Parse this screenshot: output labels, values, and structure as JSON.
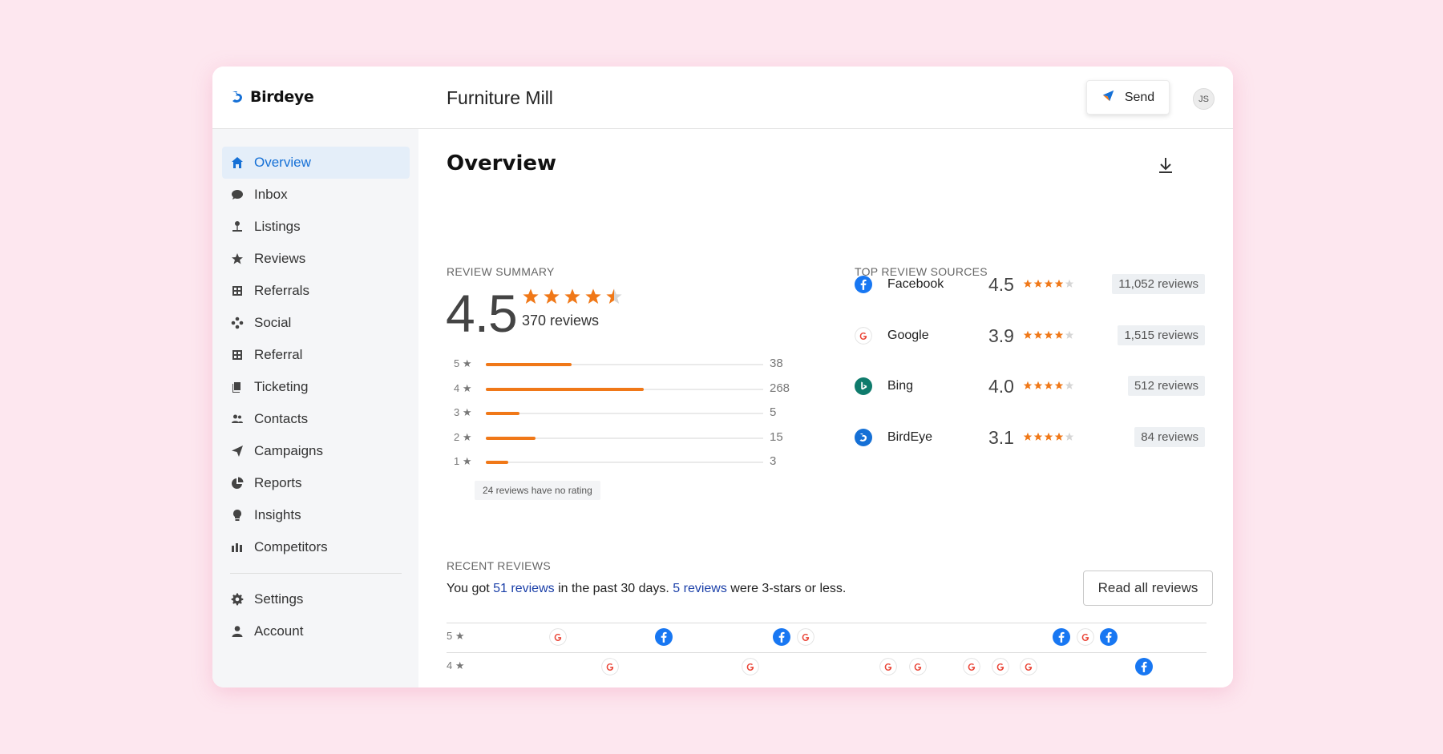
{
  "app": {
    "logo_text": "Birdeye",
    "business_name": "Furniture Mill",
    "send_label": "Send",
    "avatar_initials": "JS"
  },
  "colors": {
    "background": "#fde7ef",
    "accent": "#1570d6",
    "star": "#f07818",
    "link": "#1a3fa8"
  },
  "sidebar": {
    "items": [
      {
        "label": "Overview",
        "icon": "home-icon",
        "active": true
      },
      {
        "label": "Inbox",
        "icon": "chat-icon"
      },
      {
        "label": "Listings",
        "icon": "location-pin-icon"
      },
      {
        "label": "Reviews",
        "icon": "star-icon"
      },
      {
        "label": "Referrals",
        "icon": "referrals-icon"
      },
      {
        "label": "Social",
        "icon": "social-icon"
      },
      {
        "label": "Referral",
        "icon": "referral-icon"
      },
      {
        "label": "Ticketing",
        "icon": "ticket-icon"
      },
      {
        "label": "Contacts",
        "icon": "contacts-icon"
      },
      {
        "label": "Campaigns",
        "icon": "paper-plane-icon"
      },
      {
        "label": "Reports",
        "icon": "pie-chart-icon"
      },
      {
        "label": "Insights",
        "icon": "lightbulb-icon"
      },
      {
        "label": "Competitors",
        "icon": "bar-chart-icon"
      }
    ],
    "bottom_items": [
      {
        "label": "Settings",
        "icon": "gear-icon"
      },
      {
        "label": "Account",
        "icon": "person-icon"
      }
    ]
  },
  "main": {
    "title": "Overview",
    "review_summary": {
      "label": "REVIEW SUMMARY",
      "average": "4.5",
      "average_value": 4.5,
      "total_label": "370 reviews",
      "distribution": [
        {
          "stars": "5",
          "count": "38",
          "fill": 0.31
        },
        {
          "stars": "4",
          "count": "268",
          "fill": 0.57
        },
        {
          "stars": "3",
          "count": "5",
          "fill": 0.12
        },
        {
          "stars": "2",
          "count": "15",
          "fill": 0.18
        },
        {
          "stars": "1",
          "count": "3",
          "fill": 0.08
        }
      ],
      "no_rating_note": "24 reviews have no rating"
    },
    "top_sources": {
      "label": "TOP REVIEW SOURCES",
      "items": [
        {
          "name": "Facebook",
          "rating": "4.5",
          "stars": 4,
          "count": "11,052 reviews",
          "icon": "facebook-icon"
        },
        {
          "name": "Google",
          "rating": "3.9",
          "stars": 4,
          "count": "1,515 reviews",
          "icon": "google-icon"
        },
        {
          "name": "Bing",
          "rating": "4.0",
          "stars": 4,
          "count": "512 reviews",
          "icon": "bing-icon"
        },
        {
          "name": "BirdEye",
          "rating": "3.1",
          "stars": 4,
          "count": "84 reviews",
          "icon": "birdeye-icon"
        }
      ]
    },
    "recent_reviews": {
      "label": "RECENT REVIEWS",
      "text_1": "You got ",
      "link_1": "51 reviews",
      "text_2": " in the past 30 days. ",
      "link_2": "5 reviews",
      "text_3": " were 3-stars or less.",
      "read_all_label": "Read all reviews",
      "rows": [
        {
          "stars": "5",
          "sources": [
            "google",
            "facebook",
            "facebook",
            "google",
            "facebook",
            "google",
            "facebook"
          ]
        },
        {
          "stars": "4",
          "sources": [
            "google",
            "google",
            "google",
            "google",
            "google",
            "google",
            "google",
            "facebook"
          ]
        }
      ]
    }
  }
}
